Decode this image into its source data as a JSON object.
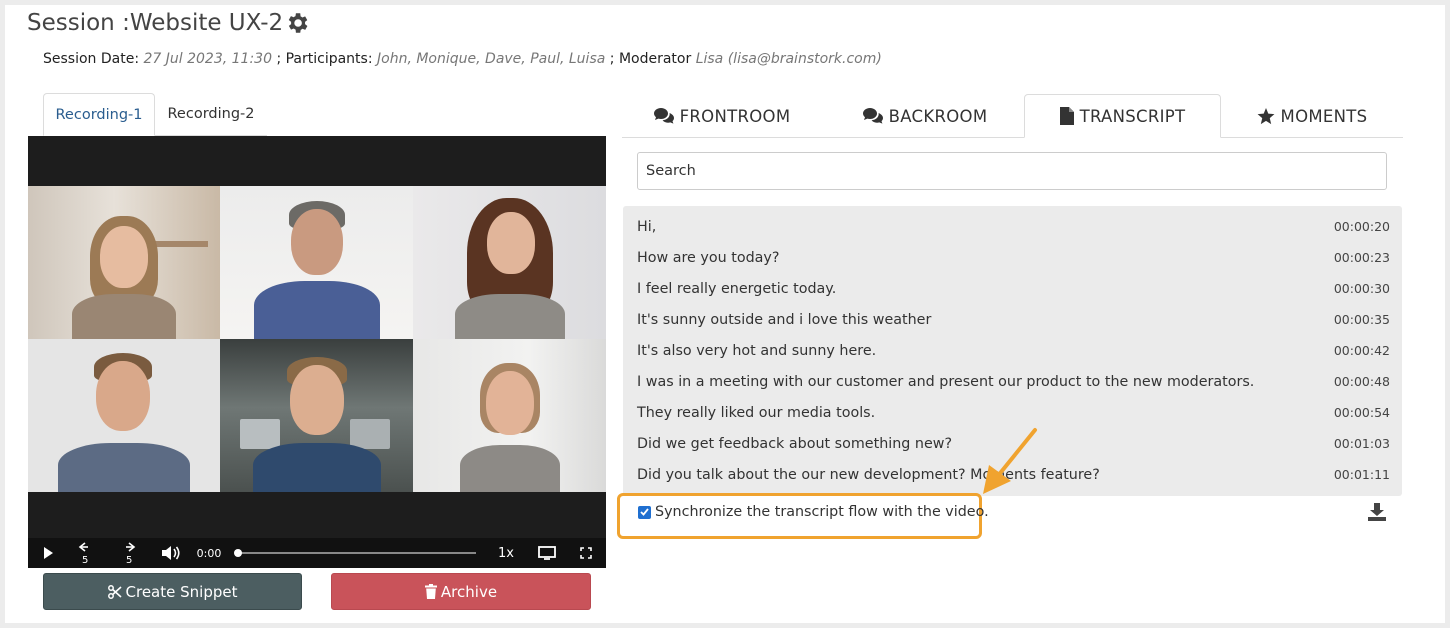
{
  "session": {
    "title": "Session :Website UX-2",
    "date_label": "Session Date:",
    "date_value": "27 Jul 2023, 11:30",
    "participants_label": "; Participants:",
    "participants_value": "John, Monique, Dave, Paul, Luisa",
    "moderator_label": "; Moderator",
    "moderator_value": "Lisa (lisa@brainstork.com)"
  },
  "recording_tabs": [
    "Recording-1",
    "Recording-2"
  ],
  "player": {
    "time": "0:00",
    "speed": "1x",
    "progress": 0,
    "skip_back": "5",
    "skip_forward": "5"
  },
  "actions": {
    "snippet": "Create Snippet",
    "archive": "Archive"
  },
  "tabs": [
    {
      "label": "FRONTROOM",
      "icon": "comments-icon"
    },
    {
      "label": "BACKROOM",
      "icon": "comments-icon"
    },
    {
      "label": "TRANSCRIPT",
      "icon": "file-icon",
      "active": true
    },
    {
      "label": "MOMENTS",
      "icon": "star-icon"
    }
  ],
  "search": {
    "placeholder": "Search",
    "value": ""
  },
  "transcript": [
    {
      "text": "Hi,",
      "time": "00:00:20"
    },
    {
      "text": "How are you today?",
      "time": "00:00:23"
    },
    {
      "text": "I feel really energetic today.",
      "time": "00:00:30"
    },
    {
      "text": "It's sunny outside and i love this weather",
      "time": "00:00:35"
    },
    {
      "text": "It's also very hot and sunny here.",
      "time": "00:00:42"
    },
    {
      "text": "I was in a meeting with our customer and present our product to the new moderators.",
      "time": "00:00:48"
    },
    {
      "text": "They really liked our media tools.",
      "time": "00:00:54"
    },
    {
      "text": "Did we get feedback about something new?",
      "time": "00:01:03"
    },
    {
      "text": "Did you talk about the our new development? Moments feature?",
      "time": "00:01:11"
    }
  ],
  "sync": {
    "label": "Synchronize the transcript flow with the video.",
    "checked": true
  },
  "colors": {
    "highlight": "#f0a32f",
    "snippet_button": "#4c5e61",
    "archive_button": "#c9535a",
    "transcript_bg": "#ebebeb"
  }
}
